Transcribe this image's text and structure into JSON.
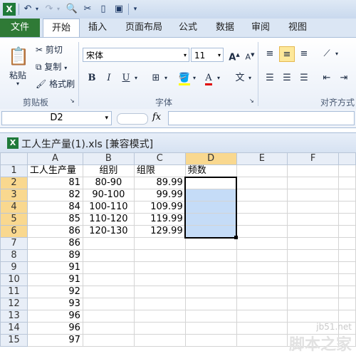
{
  "qat": {
    "excel_icon": "excel-icon",
    "items": [
      "undo-icon",
      "redo-icon",
      "print-preview-icon",
      "spelling-icon",
      "new-icon",
      "save-icon",
      "dropdown-icon"
    ]
  },
  "ribbon_tabs": [
    "文件",
    "开始",
    "插入",
    "页面布局",
    "公式",
    "数据",
    "审阅",
    "视图"
  ],
  "ribbon": {
    "clipboard": {
      "paste_label": "粘贴",
      "cut_label": "剪切",
      "copy_label": "复制",
      "format_painter_label": "格式刷",
      "group_label": "剪贴板"
    },
    "font": {
      "font_name": "宋体",
      "font_size": "11",
      "bold": "B",
      "italic": "I",
      "underline": "U",
      "font_color_glyph": "A",
      "phonetic_glyph": "文",
      "group_label": "字体"
    },
    "alignment": {
      "group_label": "对齐方式"
    }
  },
  "formula_bar": {
    "name_box": "D2",
    "fx": "fx",
    "value": ""
  },
  "workbook": {
    "title": "工人生产量(1).xls  [兼容模式]"
  },
  "grid": {
    "columns": [
      "A",
      "B",
      "C",
      "D",
      "E",
      "F"
    ],
    "rows": [
      {
        "n": "1",
        "a": "工人生产量",
        "b": "组别",
        "c": "组限",
        "d": "频数"
      },
      {
        "n": "2",
        "a": "81",
        "b": "80-90",
        "c": "89.99",
        "d": ""
      },
      {
        "n": "3",
        "a": "82",
        "b": "90-100",
        "c": "99.99",
        "d": ""
      },
      {
        "n": "4",
        "a": "84",
        "b": "100-110",
        "c": "109.99",
        "d": ""
      },
      {
        "n": "5",
        "a": "85",
        "b": "110-120",
        "c": "119.99",
        "d": ""
      },
      {
        "n": "6",
        "a": "86",
        "b": "120-130",
        "c": "129.99",
        "d": ""
      },
      {
        "n": "7",
        "a": "86",
        "b": "",
        "c": "",
        "d": ""
      },
      {
        "n": "8",
        "a": "89",
        "b": "",
        "c": "",
        "d": ""
      },
      {
        "n": "9",
        "a": "91",
        "b": "",
        "c": "",
        "d": ""
      },
      {
        "n": "10",
        "a": "91",
        "b": "",
        "c": "",
        "d": ""
      },
      {
        "n": "11",
        "a": "92",
        "b": "",
        "c": "",
        "d": ""
      },
      {
        "n": "12",
        "a": "93",
        "b": "",
        "c": "",
        "d": ""
      },
      {
        "n": "13",
        "a": "96",
        "b": "",
        "c": "",
        "d": ""
      },
      {
        "n": "14",
        "a": "96",
        "b": "",
        "c": "",
        "d": ""
      },
      {
        "n": "15",
        "a": "97",
        "b": "",
        "c": "",
        "d": ""
      }
    ]
  },
  "watermark": {
    "site": "jb51.net",
    "name": "脚本之家"
  },
  "colors": {
    "file_tab": "#2f7a36",
    "selection_fill": "#c5dcf7",
    "header_highlight": "#f9d88f"
  }
}
